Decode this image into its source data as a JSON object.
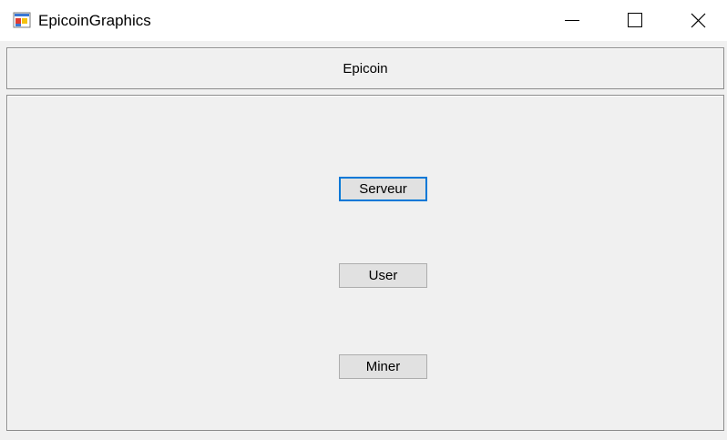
{
  "window": {
    "title": "EpicoinGraphics",
    "controls": {
      "minimize_icon": "minimize-icon",
      "maximize_icon": "maximize-icon",
      "close_icon": "close-icon"
    }
  },
  "header": {
    "label": "Epicoin"
  },
  "buttons": {
    "serveur": "Serveur",
    "user": "User",
    "miner": "Miner"
  },
  "colors": {
    "focus_border": "#0078d7",
    "button_face": "#e1e1e1",
    "panel_background": "#f0f0f0"
  }
}
